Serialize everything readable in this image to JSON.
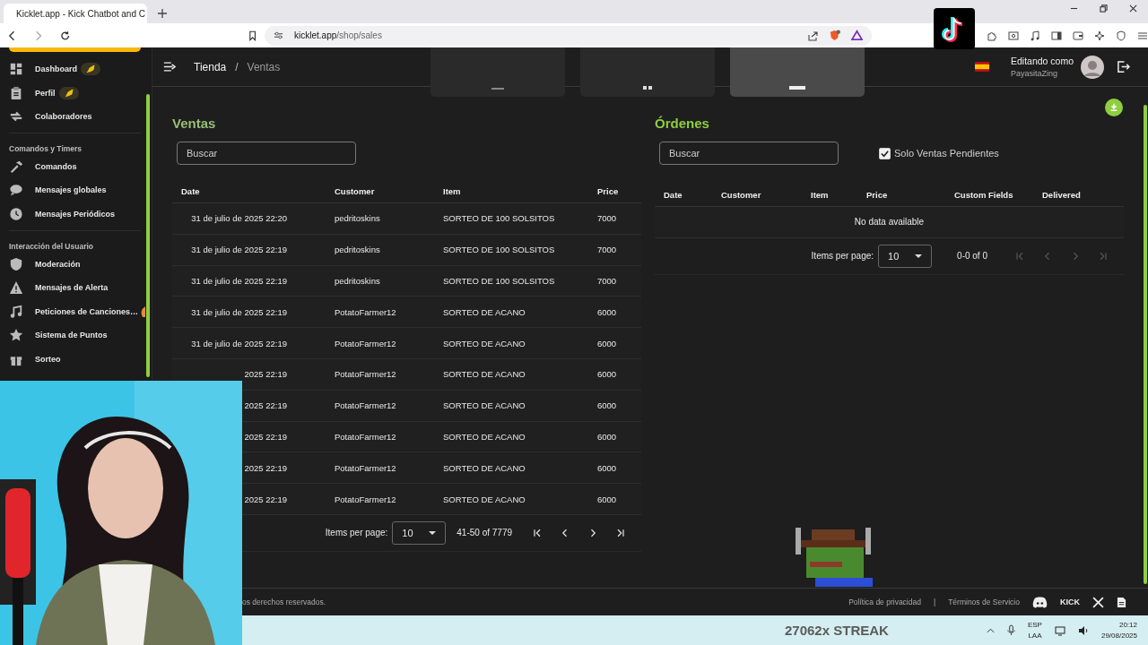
{
  "browser": {
    "tab_title": "Kicklet.app - Kick Chatbot and C",
    "url_host": "kicklet.app",
    "url_path": "/shop/sales"
  },
  "sidebar": {
    "sections": [
      {
        "items": [
          {
            "label": "Dashboard",
            "rocket_badge": true
          },
          {
            "label": "Perfil",
            "rocket_badge": true
          },
          {
            "label": "Colaboradores"
          }
        ]
      },
      {
        "title": "Comandos y Timers",
        "items": [
          {
            "label": "Comandos"
          },
          {
            "label": "Mensajes globales"
          },
          {
            "label": "Mensajes Periódicos"
          }
        ]
      },
      {
        "title": "Interacción del Usuario",
        "items": [
          {
            "label": "Moderación"
          },
          {
            "label": "Mensajes de Alerta"
          },
          {
            "label": "Peticiones de Canciones…",
            "flame_badge": true
          },
          {
            "label": "Sistema de Puntos"
          },
          {
            "label": "Sorteo"
          }
        ]
      }
    ]
  },
  "header": {
    "breadcrumb": [
      "Tienda",
      "Ventas"
    ],
    "separator": "/",
    "caption": "Editando como",
    "user": "PayasitaZing"
  },
  "ventas": {
    "title": "Ventas",
    "search": {
      "placeholder": "Buscar"
    },
    "columns": [
      "Date",
      "Customer",
      "Item",
      "Price"
    ],
    "rows": [
      {
        "date": "31 de julio de 2025 22:20",
        "customer": "pedritoskins",
        "item": "SORTEO DE 100 SOLSITOS",
        "price": "7000"
      },
      {
        "date": "31 de julio de 2025 22:19",
        "customer": "pedritoskins",
        "item": "SORTEO DE 100 SOLSITOS",
        "price": "7000"
      },
      {
        "date": "31 de julio de 2025 22:19",
        "customer": "pedritoskins",
        "item": "SORTEO DE 100 SOLSITOS",
        "price": "7000"
      },
      {
        "date": "31 de julio de 2025 22:19",
        "customer": "PotatoFarmer12",
        "item": "SORTEO DE ACANO",
        "price": "6000"
      },
      {
        "date": "31 de julio de 2025 22:19",
        "customer": "PotatoFarmer12",
        "item": "SORTEO DE ACANO",
        "price": "6000"
      },
      {
        "date": "2025 22:19",
        "customer": "PotatoFarmer12",
        "item": "SORTEO DE ACANO",
        "price": "6000"
      },
      {
        "date": "2025 22:19",
        "customer": "PotatoFarmer12",
        "item": "SORTEO DE ACANO",
        "price": "6000"
      },
      {
        "date": "2025 22:19",
        "customer": "PotatoFarmer12",
        "item": "SORTEO DE ACANO",
        "price": "6000"
      },
      {
        "date": "2025 22:19",
        "customer": "PotatoFarmer12",
        "item": "SORTEO DE ACANO",
        "price": "6000"
      },
      {
        "date": "2025 22:19",
        "customer": "PotatoFarmer12",
        "item": "SORTEO DE ACANO",
        "price": "6000"
      }
    ],
    "pagination": {
      "label": "Items per page:",
      "per_page": "10",
      "range": "41-50 of 7779",
      "nav_disabled": false
    }
  },
  "ordenes": {
    "title": "Órdenes",
    "search": {
      "placeholder": "Buscar"
    },
    "filter": {
      "label": "Solo Ventas Pendientes",
      "checked": true
    },
    "columns": [
      "Date",
      "Customer",
      "Item",
      "Price",
      "Custom Fields",
      "Delivered"
    ],
    "empty": "No data available",
    "pagination": {
      "label": "Items per page:",
      "per_page": "10",
      "range": "0-0 of 0",
      "nav_disabled": true
    }
  },
  "footer": {
    "copyright": "os derechos reservados.",
    "links": [
      "Política de privacidad",
      "Términos de Servicio"
    ],
    "separator": "|",
    "kick": "KICK"
  },
  "overlay": {
    "streak": "27062x STREAK"
  },
  "taskbar": {
    "language": "ESP",
    "layout": "LAA",
    "time": "20:12",
    "date": "29/08/2025"
  }
}
